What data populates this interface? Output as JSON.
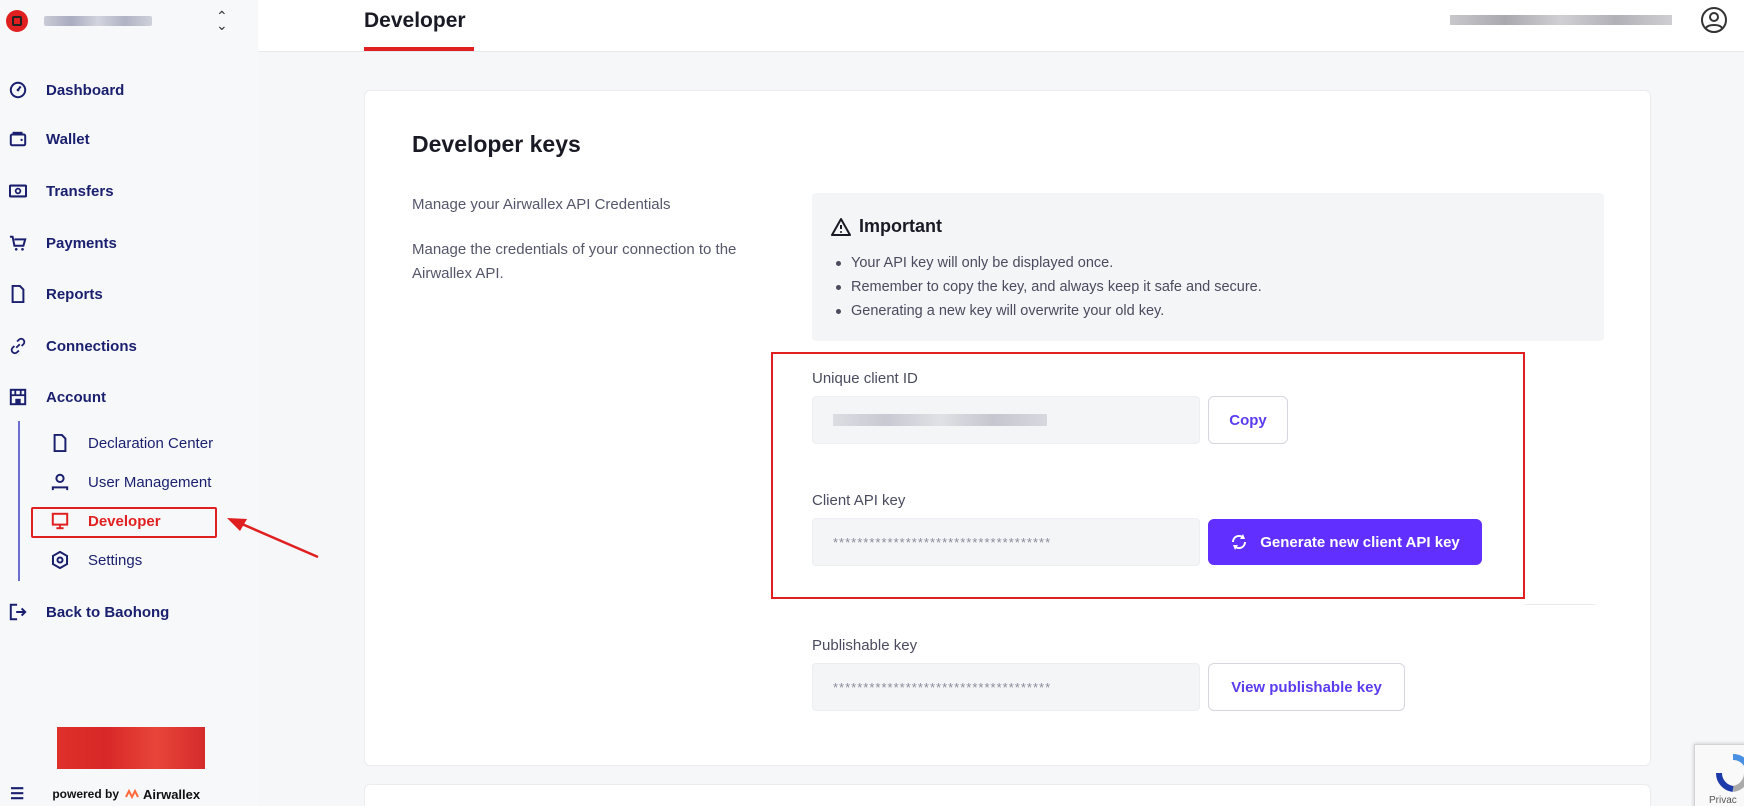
{
  "sidebar": {
    "nav": [
      {
        "label": "Dashboard",
        "icon": "gauge-icon"
      },
      {
        "label": "Wallet",
        "icon": "wallet-icon"
      },
      {
        "label": "Transfers",
        "icon": "banknote-icon"
      },
      {
        "label": "Payments",
        "icon": "cart-icon"
      },
      {
        "label": "Reports",
        "icon": "document-icon"
      },
      {
        "label": "Connections",
        "icon": "link-icon"
      },
      {
        "label": "Account",
        "icon": "store-icon"
      }
    ],
    "sub": [
      {
        "label": "Declaration Center",
        "icon": "document-icon"
      },
      {
        "label": "User Management",
        "icon": "user-icon"
      },
      {
        "label": "Developer",
        "icon": "monitor-icon"
      },
      {
        "label": "Settings",
        "icon": "gear-icon"
      }
    ],
    "back_label": "Back to Baohong",
    "powered_by": "powered by",
    "brand": "Airwallex",
    "highlight_color": "#e02020"
  },
  "header": {
    "title": "Developer"
  },
  "card": {
    "title": "Developer keys",
    "desc1": "Manage your Airwallex API Credentials",
    "desc2": "Manage the credentials of your connection to the Airwallex API.",
    "important": {
      "title": "Important",
      "items": [
        "Your API key will only be displayed once.",
        "Remember to copy the key, and always keep it safe and secure.",
        "Generating a new key will overwrite your old key."
      ]
    },
    "client_id": {
      "label": "Unique client ID",
      "button": "Copy"
    },
    "client_key": {
      "label": "Client API key",
      "value": "************************************",
      "button": "Generate new client API key"
    },
    "publishable_key": {
      "label": "Publishable key",
      "value": "************************************",
      "button": "View publishable key"
    }
  },
  "recaptcha": {
    "text": "Privac"
  },
  "colors": {
    "accent": "#612fff",
    "nav_text": "#1a1f6e",
    "highlight": "#e02020"
  }
}
